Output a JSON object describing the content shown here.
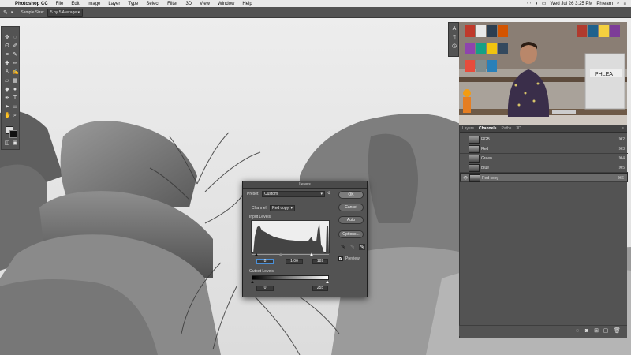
{
  "menubar": {
    "app_name": "Photoshop CC",
    "items": [
      "File",
      "Edit",
      "Image",
      "Layer",
      "Type",
      "Select",
      "Filter",
      "3D",
      "View",
      "Window",
      "Help"
    ],
    "datetime": "Wed Jul 26  3:25 PM",
    "user": "Phlearn"
  },
  "options_bar": {
    "sample_size_label": "Sample Size:",
    "sample_size_value": "5 by 5 Average"
  },
  "levels": {
    "title": "Levels",
    "preset_label": "Preset:",
    "preset_value": "Custom",
    "channel_label": "Channel:",
    "channel_value": "Red copy",
    "input_levels_label": "Input Levels:",
    "input_black": "8",
    "input_gamma": "1.00",
    "input_white": "189",
    "output_levels_label": "Output Levels:",
    "output_black": "0",
    "output_white": "255",
    "ok_label": "OK",
    "cancel_label": "Cancel",
    "auto_label": "Auto",
    "options_label": "Options...",
    "preview_label": "Preview",
    "preview_checked": true
  },
  "channels_panel": {
    "tabs": [
      "Layers",
      "Channels",
      "Paths",
      "3D"
    ],
    "active_tab": "Channels",
    "rows": [
      {
        "name": "RGB",
        "shortcut": "⌘2"
      },
      {
        "name": "Red",
        "shortcut": "⌘3"
      },
      {
        "name": "Green",
        "shortcut": "⌘4"
      },
      {
        "name": "Blue",
        "shortcut": "⌘5"
      },
      {
        "name": "Red copy",
        "shortcut": "⌘6"
      }
    ],
    "selected_row": "Red copy"
  },
  "colors": {
    "ui_panel": "#535353",
    "menubar": "#e9e9e9",
    "selected_row": "#6b6b6b"
  }
}
